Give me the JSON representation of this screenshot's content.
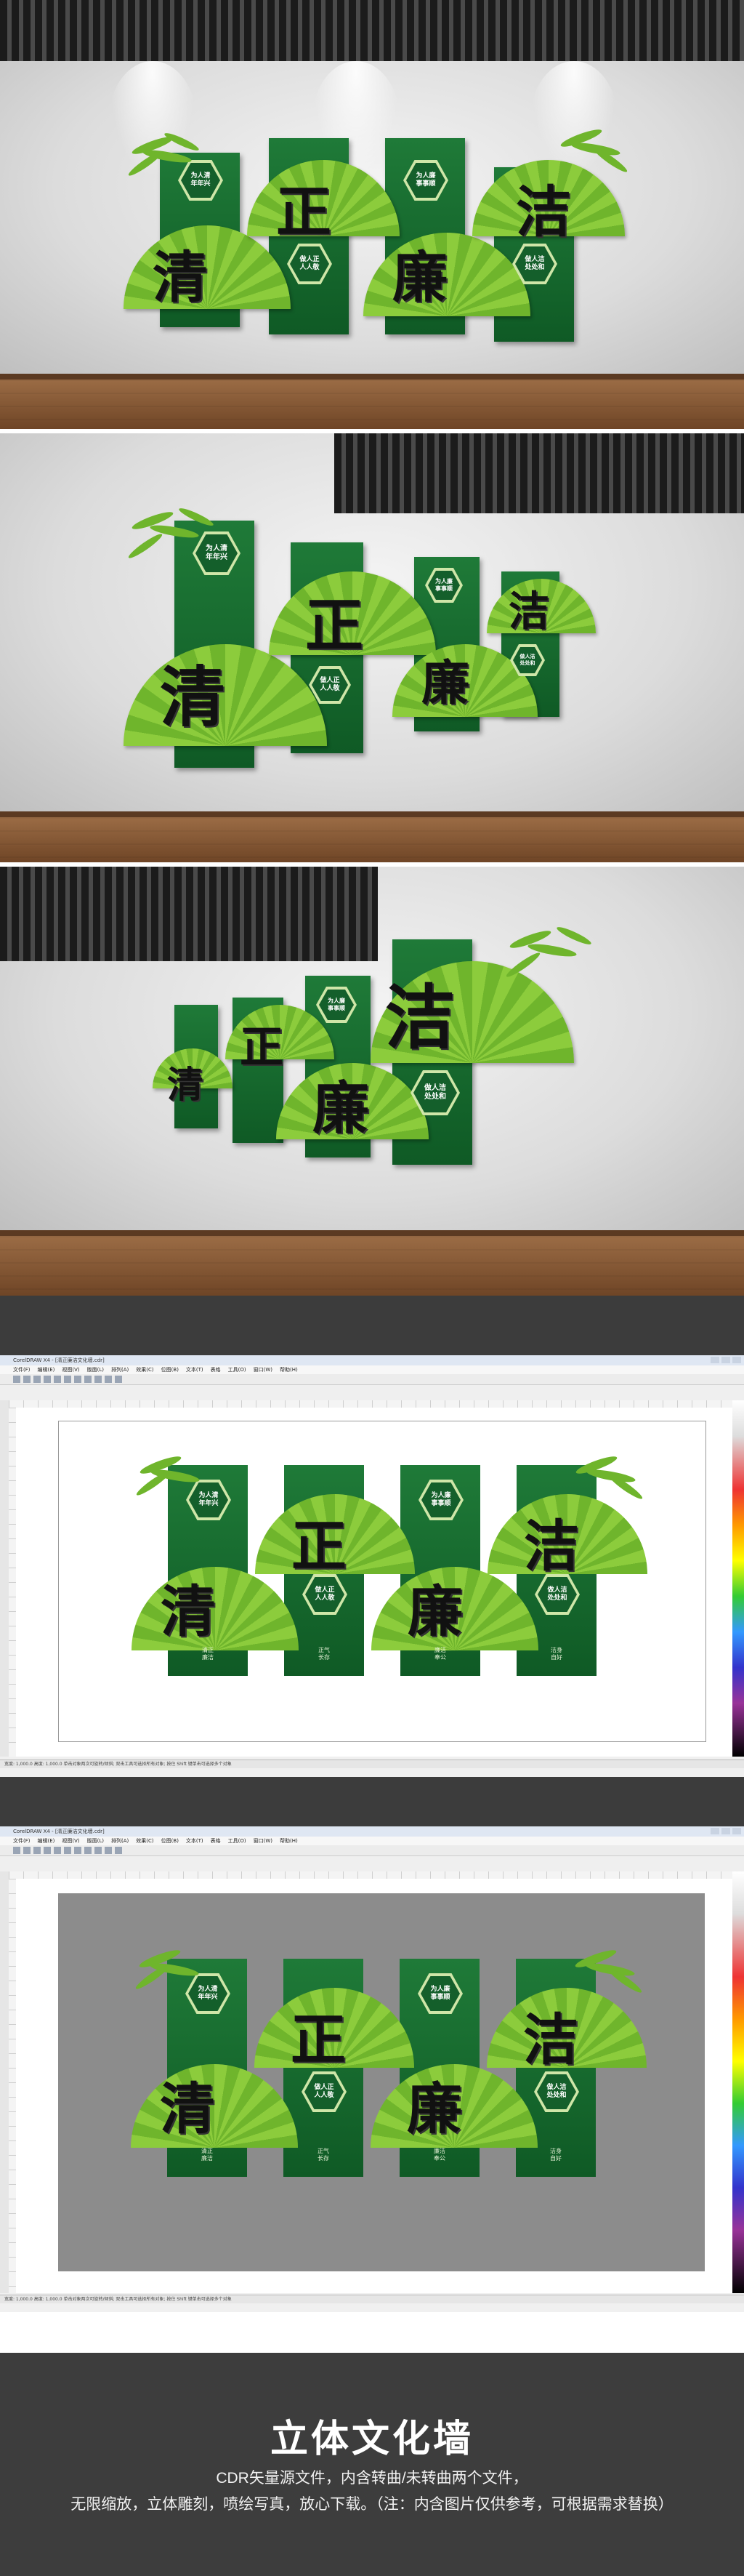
{
  "mural": {
    "characters": [
      "清",
      "正",
      "廉",
      "洁"
    ],
    "hex_labels": [
      "为人清\n年年兴",
      "做人正\n人人敬",
      "为人廉\n事事顺",
      "做人洁\n处处和"
    ],
    "bottom_labels": [
      "清正\n廉洁",
      "正气\n长存",
      "廉洁\n奉公",
      "洁身\n自好"
    ]
  },
  "software": {
    "title": "CorelDRAW X4 - [清正廉洁文化墙.cdr]",
    "menu": [
      "文件(F)",
      "编辑(E)",
      "视图(V)",
      "版面(L)",
      "排列(A)",
      "效果(C)",
      "位图(B)",
      "文本(T)",
      "表格",
      "工具(O)",
      "窗口(W)",
      "帮助(H)"
    ],
    "status_text": "宽度: 1,000.0 高度: 1,000.0  单击对象两次可旋转/倾斜; 双击工具可选择所有对象; 按住 Shift 键单击可选择多个对象"
  },
  "footer": {
    "title": "立体文化墙",
    "line1": "CDR矢量源文件，内含转曲/未转曲两个文件，",
    "line2": "无限缩放，立体雕刻，喷绘写真，放心下载。（注：内含图片仅供参考，可根据需求替换）"
  }
}
